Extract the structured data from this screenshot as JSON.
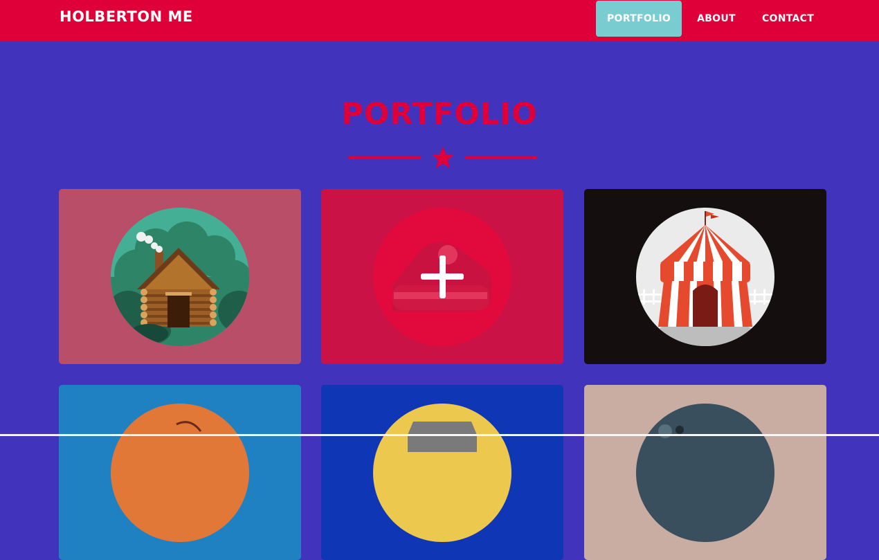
{
  "navbar": {
    "brand": "HOLBERTON ME",
    "links": [
      "PORTFOLIO",
      "ABOUT",
      "CONTACT"
    ],
    "active": "PORTFOLIO"
  },
  "portfolio": {
    "title": "PORTFOLIO",
    "divider_icon": "star-icon",
    "items": [
      {
        "image": "cabin-illustration",
        "background": "#b84e67"
      },
      {
        "image": "cake-illustration-hover-plus",
        "background": "#cb1246"
      },
      {
        "image": "circus-tent-illustration",
        "background": "#140e0e"
      },
      {
        "image": "orange-circle-illustration",
        "background": "#1f80c2"
      },
      {
        "image": "yellow-circle-illustration",
        "background": "#0f36b5"
      },
      {
        "image": "slate-circle-illustration",
        "background": "#c9ada2"
      }
    ]
  },
  "colors": {
    "primary": "#e00039",
    "background": "#4233bd",
    "active_link": "#79cdd1"
  }
}
